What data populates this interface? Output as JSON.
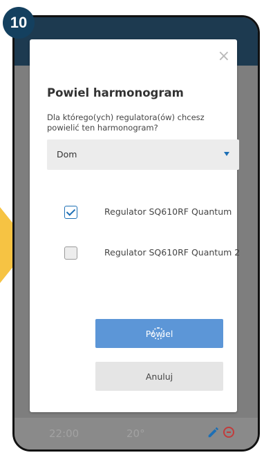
{
  "step_badge": "10",
  "dialog": {
    "close_symbol": "×",
    "title": "Powiel harmonogram",
    "subtitle": "Dla którego(ych) regulatora(ów) chcesz powielić ten harmonogram?",
    "select": {
      "value": "Dom"
    },
    "regulators": [
      {
        "label": "Regulator SQ610RF Quantum",
        "checked": true
      },
      {
        "label": "Regulator SQ610RF Quantum 2",
        "checked": false
      }
    ],
    "confirm_label": "Powiel",
    "cancel_label": "Anuluj"
  },
  "background_row": {
    "time": "22:00",
    "temperature": "20°"
  },
  "colors": {
    "accent": "#1d6fb5",
    "primary_button": "#5c96d7",
    "arrow": "#f6c343",
    "badge": "#14405f"
  }
}
